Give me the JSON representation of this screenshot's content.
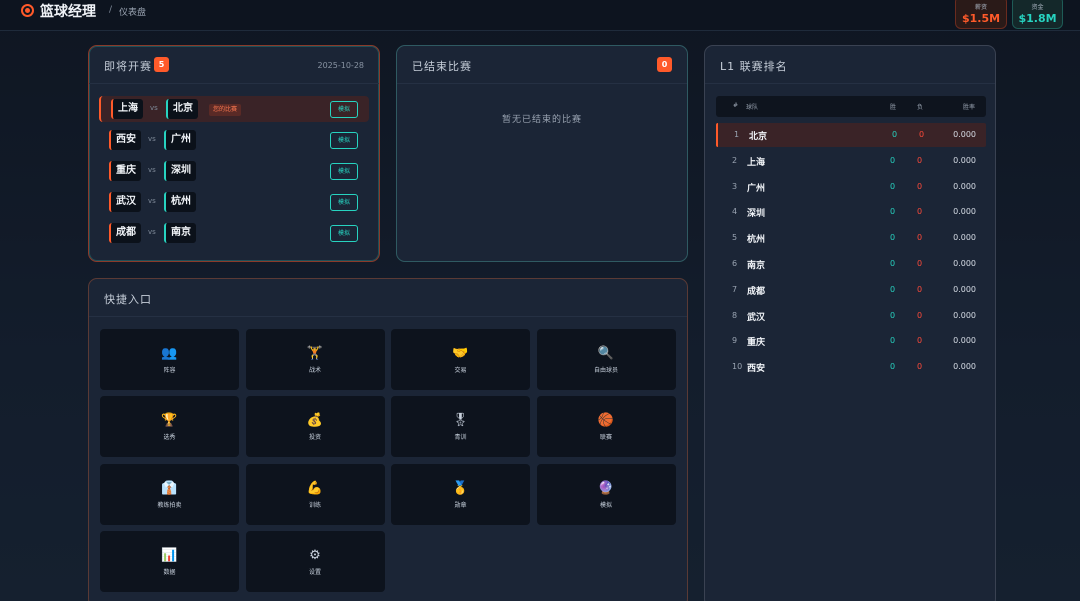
{
  "header": {
    "app_title": "篮球经理",
    "breadcrumb_sep": "/",
    "breadcrumb": "仪表盘",
    "money": [
      {
        "label": "薪资",
        "value": "$1.5M"
      },
      {
        "label": "资金",
        "value": "$1.8M"
      }
    ]
  },
  "upcoming": {
    "title": "即将开赛",
    "count": "5",
    "date": "2025-10-28",
    "vs_label": "vs",
    "my_match_tag": "您的比赛",
    "sim_label": "模拟",
    "matches": [
      {
        "home": "上海",
        "away": "北京"
      },
      {
        "home": "西安",
        "away": "广州"
      },
      {
        "home": "重庆",
        "away": "深圳"
      },
      {
        "home": "武汉",
        "away": "杭州"
      },
      {
        "home": "成都",
        "away": "南京"
      }
    ]
  },
  "finished": {
    "title": "已结束比赛",
    "count": "0",
    "empty_text": "暂无已结束的比赛"
  },
  "quick": {
    "title": "快捷入口",
    "tiles": [
      {
        "icon": "👥",
        "label": "阵容"
      },
      {
        "icon": "🏋",
        "label": "战术"
      },
      {
        "icon": "🤝",
        "label": "交易"
      },
      {
        "icon": "🔍",
        "label": "自由球员"
      },
      {
        "icon": "🏆",
        "label": "选秀"
      },
      {
        "icon": "💰",
        "label": "投资"
      },
      {
        "icon": "🎖",
        "label": "青训"
      },
      {
        "icon": "🏀",
        "label": "联赛"
      },
      {
        "icon": "👔",
        "label": "教练拍卖"
      },
      {
        "icon": "💪",
        "label": "训练"
      },
      {
        "icon": "🥇",
        "label": "勋章"
      },
      {
        "icon": "🔮",
        "label": "模拟"
      },
      {
        "icon": "📊",
        "label": "数据"
      },
      {
        "icon": "⚙",
        "label": "设置"
      }
    ]
  },
  "ranking": {
    "title": "L1 联赛排名",
    "columns": {
      "pos": "#",
      "team": "球队",
      "w": "胜",
      "l": "负",
      "pct": "胜率"
    },
    "rows": [
      {
        "pos": "1",
        "team": "北京",
        "w": "0",
        "l": "0",
        "pct": "0.000"
      },
      {
        "pos": "2",
        "team": "上海",
        "w": "0",
        "l": "0",
        "pct": "0.000"
      },
      {
        "pos": "3",
        "team": "广州",
        "w": "0",
        "l": "0",
        "pct": "0.000"
      },
      {
        "pos": "4",
        "team": "深圳",
        "w": "0",
        "l": "0",
        "pct": "0.000"
      },
      {
        "pos": "5",
        "team": "杭州",
        "w": "0",
        "l": "0",
        "pct": "0.000"
      },
      {
        "pos": "6",
        "team": "南京",
        "w": "0",
        "l": "0",
        "pct": "0.000"
      },
      {
        "pos": "7",
        "team": "成都",
        "w": "0",
        "l": "0",
        "pct": "0.000"
      },
      {
        "pos": "8",
        "team": "武汉",
        "w": "0",
        "l": "0",
        "pct": "0.000"
      },
      {
        "pos": "9",
        "team": "重庆",
        "w": "0",
        "l": "0",
        "pct": "0.000"
      },
      {
        "pos": "10",
        "team": "西安",
        "w": "0",
        "l": "0",
        "pct": "0.000"
      }
    ]
  },
  "colors": {
    "accent_orange": "#ff5a2a",
    "accent_teal": "#27d3c0",
    "loss_red": "#ff4a3a"
  }
}
